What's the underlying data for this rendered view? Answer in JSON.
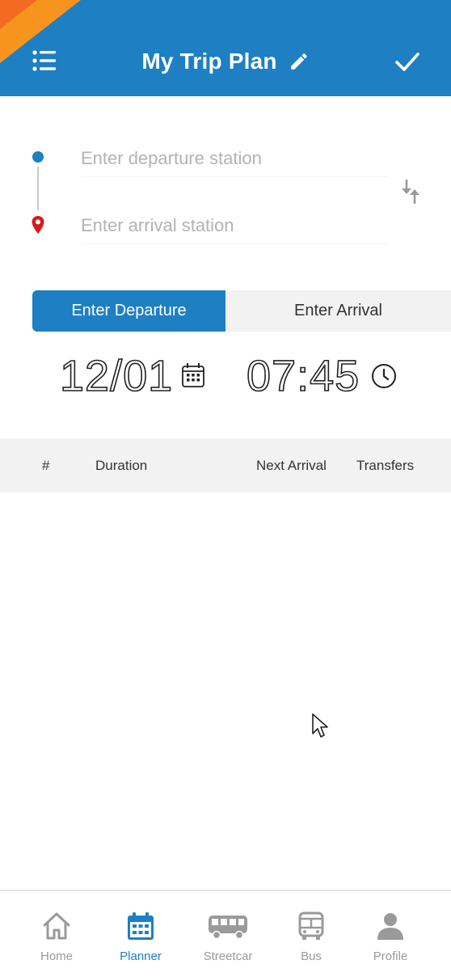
{
  "header": {
    "title": "My Trip Plan",
    "menu_icon": "list-menu-icon",
    "edit_icon": "pencil-icon",
    "confirm_icon": "check-icon",
    "background": "#1e7fc3",
    "accent_corner": "#f7941d"
  },
  "stations": {
    "departure_placeholder": "Enter departure station",
    "departure_value": "",
    "arrival_placeholder": "Enter arrival station",
    "arrival_value": "",
    "swap_icon": "swap-vertical-icon"
  },
  "mode_toggle": {
    "departure_label": "Enter Departure",
    "arrival_label": "Enter Arrival",
    "selected": "Enter Departure"
  },
  "datetime": {
    "date": "12/01",
    "time": "07:45",
    "date_icon": "calendar-icon",
    "time_icon": "clock-icon"
  },
  "results_table": {
    "columns": [
      "#",
      "Duration",
      "Next Arrival",
      "Transfers"
    ],
    "rows": []
  },
  "bottom_nav": {
    "items": [
      {
        "label": "Home",
        "icon": "home-icon"
      },
      {
        "label": "Planner",
        "icon": "calendar-icon"
      },
      {
        "label": "Streetcar",
        "icon": "streetcar-icon"
      },
      {
        "label": "Bus",
        "icon": "bus-icon"
      },
      {
        "label": "Profile",
        "icon": "person-icon"
      }
    ],
    "active": "Planner",
    "active_color": "#1e7fc3",
    "inactive_color": "#9a9a9a"
  }
}
